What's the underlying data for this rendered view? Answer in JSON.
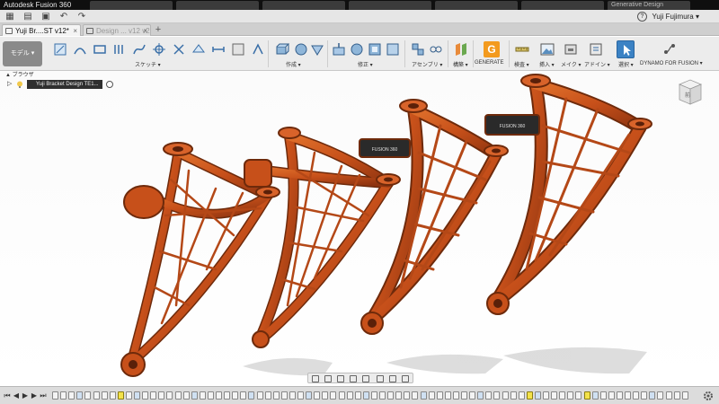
{
  "window": {
    "title": "Autodesk Fusion 360",
    "browser_tabs": [
      "Autodesk Fusion 360",
      "",
      "",
      "",
      "",
      "",
      "Generative Design"
    ]
  },
  "quick_access": {
    "user_name": "Yuji Fujimura ▾",
    "help_label": "?"
  },
  "doc_tabs": [
    {
      "label": "Yuji Br....ST v12*",
      "close": "×"
    },
    {
      "label": "Design ... v12 v2",
      "close": "×"
    }
  ],
  "ribbon": {
    "workspace_label": "モデル ▾",
    "groups": {
      "sketch": "スケッチ ▾",
      "create": "作成 ▾",
      "modify": "修正 ▾",
      "assemble": "アセンブリ ▾",
      "construct": "構築 ▾",
      "generate": "GENERATE",
      "inspect": "検査 ▾",
      "insert": "挿入 ▾",
      "make": "メイク ▾",
      "addins": "アドイン ▾",
      "select": "選択 ▾",
      "dynamo": "DYNAMO FOR FUSION ▾"
    },
    "generate_letter": "G"
  },
  "browser": {
    "header": "▲ ブラウザ",
    "root_label": "Yuji Bracket Design TE1...",
    "expand_arrow": "▷"
  },
  "viewport": {
    "model_color": "#c7501a",
    "model_edge_color": "#6e2a0b",
    "badge_text": "FUSION 360",
    "viewcube_label": "前"
  },
  "timeline": {
    "controls": [
      "⏮",
      "◀",
      "▶",
      "▶",
      "⏭"
    ]
  }
}
